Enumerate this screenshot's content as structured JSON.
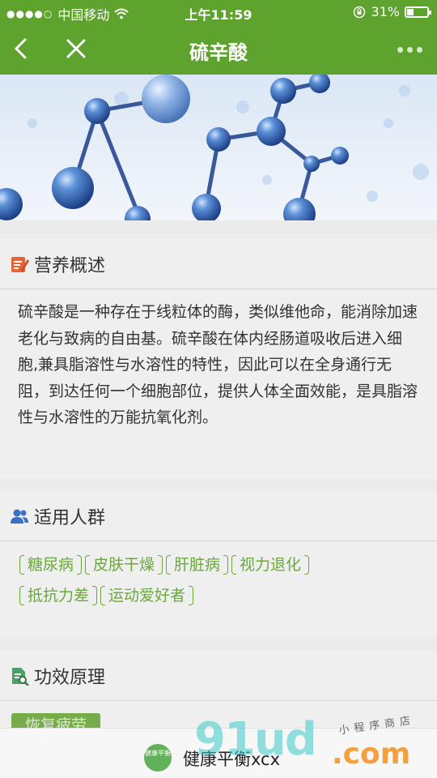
{
  "status_bar": {
    "carrier": "中国移动",
    "time": "上午11:59",
    "battery": "31%"
  },
  "nav": {
    "title": "硫辛酸"
  },
  "overview": {
    "heading": "营养概述",
    "text": "硫辛酸是一种存在于线粒体的酶，类似维他命，能消除加速老化与致病的自由基。硫辛酸在体内经肠道吸收后进入细胞,兼具脂溶性与水溶性的特性，因此可以在全身通行无阻，到达任何一个细胞部位，提供人体全面效能，是具脂溶性与水溶性的万能抗氧化剂。"
  },
  "audience": {
    "heading": "适用人群",
    "tags": [
      "糖尿病",
      "皮肤干燥",
      "肝脏病",
      "视力退化",
      "抵抗力差",
      "运动爱好者"
    ]
  },
  "effect": {
    "heading": "功效原理",
    "button": "恢复疲劳"
  },
  "bottom_bar": {
    "logo_text": "健康平衡",
    "app_name": "健康平衡xcx"
  },
  "watermark": {
    "big": "91ud",
    "com": ".com",
    "small": "小程序商店"
  },
  "colors": {
    "brand_green": "#5ea32e",
    "tag_green": "#6aa83c",
    "overview_icon": "#e8623a",
    "audience_icon": "#3d6fc4",
    "effect_icon": "#4ea06a"
  }
}
